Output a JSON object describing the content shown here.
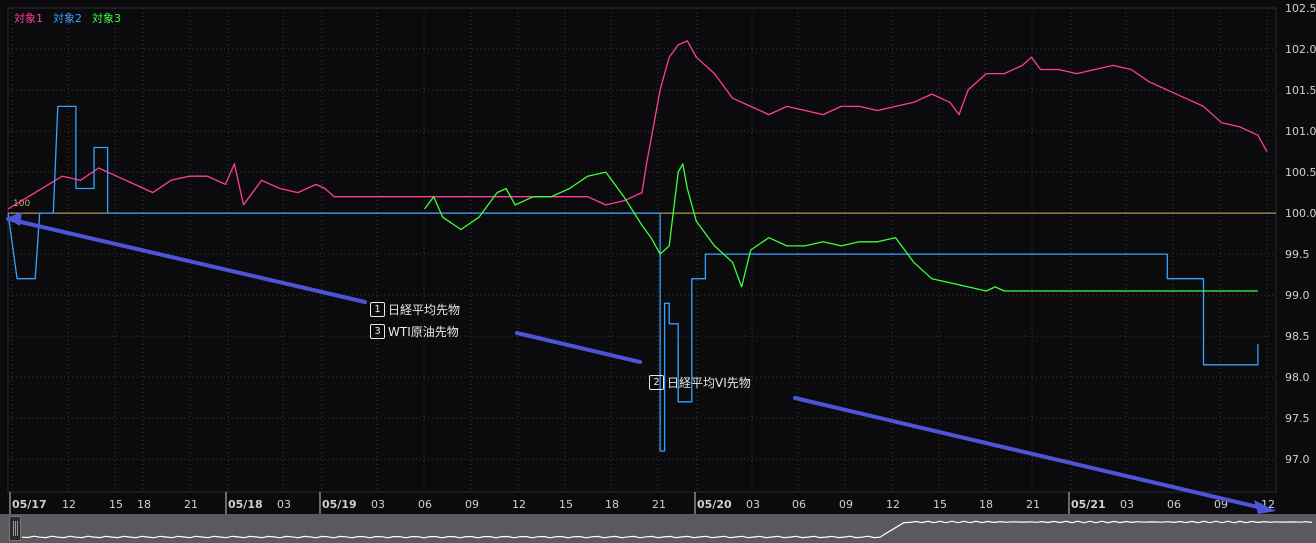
{
  "legend": [
    {
      "label": "対象1",
      "color": "#ff3d9a"
    },
    {
      "label": "対象2",
      "color": "#3aa0ff"
    },
    {
      "label": "対象3",
      "color": "#3dff3d"
    }
  ],
  "annotations": [
    {
      "num": "1",
      "text": "日経平均先物"
    },
    {
      "num": "3",
      "text": "WTI原油先物"
    },
    {
      "num": "2",
      "text": "日経平均VI先物"
    }
  ],
  "baseline_label": "100",
  "colors": {
    "background": "#0b0b0d",
    "baseline": "#d9b25a",
    "grid": "#3a3a3e",
    "arrow": "#4b55d6"
  },
  "chart_data": {
    "type": "line",
    "y_axis": {
      "min": 96.6,
      "max": 102.5,
      "ticks": [
        "102.5",
        "102.0",
        "101.5",
        "101.0",
        "100.5",
        "100.0",
        "99.5",
        "99.0",
        "98.5",
        "98.0",
        "97.5",
        "97.0"
      ],
      "position": "right"
    },
    "x_axis": {
      "ticks": [
        {
          "label": "05/17",
          "major": true
        },
        {
          "label": "12"
        },
        {
          "label": "15"
        },
        {
          "label": "18"
        },
        {
          "label": "21"
        },
        {
          "label": "05/18",
          "major": true
        },
        {
          "label": "03"
        },
        {
          "label": "05/19",
          "major": true
        },
        {
          "label": "03"
        },
        {
          "label": "06"
        },
        {
          "label": "09"
        },
        {
          "label": "12"
        },
        {
          "label": "15"
        },
        {
          "label": "18"
        },
        {
          "label": "21"
        },
        {
          "label": "05/20",
          "major": true
        },
        {
          "label": "03"
        },
        {
          "label": "06"
        },
        {
          "label": "09"
        },
        {
          "label": "12"
        },
        {
          "label": "15"
        },
        {
          "label": "18"
        },
        {
          "label": "21"
        },
        {
          "label": "05/21",
          "major": true
        },
        {
          "label": "03"
        },
        {
          "label": "06"
        },
        {
          "label": "09"
        },
        {
          "label": "12"
        }
      ]
    },
    "grid": true,
    "baseline": 100.0,
    "series": [
      {
        "name": "対象1",
        "color": "#ff3d9a",
        "values": [
          [
            0,
            100.05
          ],
          [
            3,
            100.25
          ],
          [
            6,
            100.45
          ],
          [
            8,
            100.4
          ],
          [
            10,
            100.55
          ],
          [
            12,
            100.45
          ],
          [
            14,
            100.35
          ],
          [
            16,
            100.25
          ],
          [
            18,
            100.4
          ],
          [
            20,
            100.45
          ],
          [
            22,
            100.45
          ],
          [
            24,
            100.35
          ],
          [
            25,
            100.6
          ],
          [
            26,
            100.1
          ],
          [
            28,
            100.4
          ],
          [
            30,
            100.3
          ],
          [
            32,
            100.25
          ],
          [
            34,
            100.35
          ],
          [
            35,
            100.3
          ],
          [
            36,
            100.2
          ],
          [
            37,
            100.2
          ],
          [
            64,
            100.2
          ],
          [
            66,
            100.1
          ],
          [
            68,
            100.15
          ],
          [
            70,
            100.25
          ],
          [
            70.5,
            100.6
          ],
          [
            71,
            100.9
          ],
          [
            72,
            101.5
          ],
          [
            73,
            101.9
          ],
          [
            74,
            102.05
          ],
          [
            75,
            102.1
          ],
          [
            76,
            101.9
          ],
          [
            78,
            101.7
          ],
          [
            80,
            101.4
          ],
          [
            82,
            101.3
          ],
          [
            84,
            101.2
          ],
          [
            86,
            101.3
          ],
          [
            88,
            101.25
          ],
          [
            90,
            101.2
          ],
          [
            92,
            101.3
          ],
          [
            94,
            101.3
          ],
          [
            96,
            101.25
          ],
          [
            98,
            101.3
          ],
          [
            100,
            101.35
          ],
          [
            102,
            101.45
          ],
          [
            104,
            101.35
          ],
          [
            105,
            101.2
          ],
          [
            106,
            101.5
          ],
          [
            108,
            101.7
          ],
          [
            110,
            101.7
          ],
          [
            112,
            101.8
          ],
          [
            113,
            101.9
          ],
          [
            114,
            101.75
          ],
          [
            116,
            101.75
          ],
          [
            118,
            101.7
          ],
          [
            120,
            101.75
          ],
          [
            122,
            101.8
          ],
          [
            124,
            101.75
          ],
          [
            126,
            101.6
          ],
          [
            128,
            101.5
          ],
          [
            130,
            101.4
          ],
          [
            132,
            101.3
          ],
          [
            134,
            101.1
          ],
          [
            136,
            101.05
          ],
          [
            138,
            100.95
          ],
          [
            139,
            100.75
          ]
        ]
      },
      {
        "name": "対象2",
        "color": "#3aa0ff",
        "values": [
          [
            0,
            100.0
          ],
          [
            1,
            99.2
          ],
          [
            3,
            99.2
          ],
          [
            3.5,
            100.0
          ],
          [
            5,
            100.0
          ],
          [
            5.5,
            101.3
          ],
          [
            7.5,
            101.3
          ],
          [
            7.5,
            100.3
          ],
          [
            9.5,
            100.3
          ],
          [
            9.5,
            100.8
          ],
          [
            11,
            100.8
          ],
          [
            11,
            100.0
          ],
          [
            12,
            100.0
          ],
          [
            72,
            100.0
          ],
          [
            72,
            97.1
          ],
          [
            72.5,
            97.1
          ],
          [
            72.5,
            98.9
          ],
          [
            73,
            98.9
          ],
          [
            73,
            98.65
          ],
          [
            74,
            98.65
          ],
          [
            74,
            97.7
          ],
          [
            75.5,
            97.7
          ],
          [
            75.5,
            99.2
          ],
          [
            77,
            99.2
          ],
          [
            77,
            99.5
          ],
          [
            100,
            99.5
          ],
          [
            128,
            99.5
          ],
          [
            128,
            99.2
          ],
          [
            132,
            99.2
          ],
          [
            132,
            98.15
          ],
          [
            138,
            98.15
          ],
          [
            138,
            98.4
          ]
        ]
      },
      {
        "name": "対象3",
        "color": "#3dff3d",
        "values": [
          [
            46,
            100.05
          ],
          [
            47,
            100.2
          ],
          [
            48,
            99.95
          ],
          [
            50,
            99.8
          ],
          [
            52,
            99.95
          ],
          [
            54,
            100.25
          ],
          [
            55,
            100.3
          ],
          [
            56,
            100.1
          ],
          [
            58,
            100.2
          ],
          [
            60,
            100.2
          ],
          [
            62,
            100.3
          ],
          [
            64,
            100.45
          ],
          [
            66,
            100.5
          ],
          [
            68,
            100.2
          ],
          [
            70,
            99.85
          ],
          [
            71,
            99.7
          ],
          [
            72,
            99.5
          ],
          [
            73,
            99.6
          ],
          [
            74,
            100.5
          ],
          [
            74.5,
            100.6
          ],
          [
            75,
            100.3
          ],
          [
            76,
            99.9
          ],
          [
            78,
            99.6
          ],
          [
            80,
            99.4
          ],
          [
            81,
            99.1
          ],
          [
            82,
            99.55
          ],
          [
            84,
            99.7
          ],
          [
            86,
            99.6
          ],
          [
            88,
            99.6
          ],
          [
            90,
            99.65
          ],
          [
            92,
            99.6
          ],
          [
            94,
            99.65
          ],
          [
            96,
            99.65
          ],
          [
            98,
            99.7
          ],
          [
            100,
            99.4
          ],
          [
            102,
            99.2
          ],
          [
            104,
            99.15
          ],
          [
            106,
            99.1
          ],
          [
            108,
            99.05
          ],
          [
            109,
            99.1
          ],
          [
            110,
            99.05
          ],
          [
            138,
            99.05
          ]
        ]
      }
    ],
    "x_domain": [
      0,
      140
    ]
  }
}
